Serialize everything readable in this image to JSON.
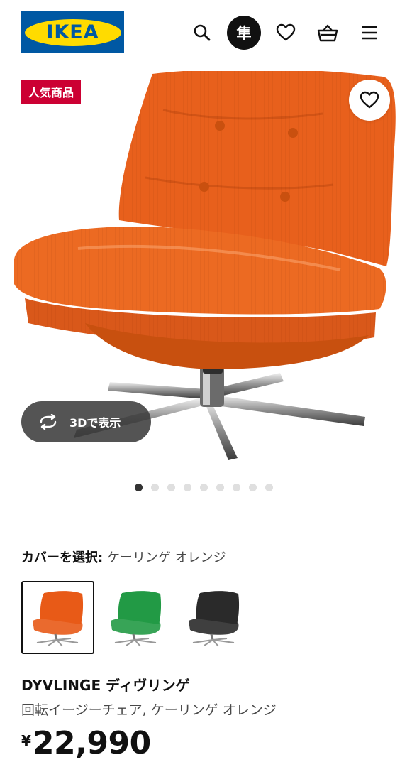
{
  "header": {
    "logo_text": "IKEA",
    "icons": [
      "search-icon",
      "store-icon",
      "heart-icon",
      "cart-icon",
      "menu-icon"
    ],
    "store_badge": "隼"
  },
  "gallery": {
    "badge": "人気商品",
    "view_3d_label": "3Dで表示",
    "image_count": 9,
    "active_index": 0
  },
  "cover": {
    "label": "カバーを選択:",
    "value": "ケーリンゲ オレンジ",
    "options": [
      {
        "color": "#e85a17",
        "selected": true
      },
      {
        "color": "#229a45",
        "selected": false
      },
      {
        "color": "#2a2a2a",
        "selected": false
      }
    ]
  },
  "product": {
    "name": "DYVLINGE ディヴリンゲ",
    "description": "回転イージーチェア, ケーリンゲ オレンジ",
    "currency": "¥",
    "price": "22,990"
  },
  "colors": {
    "ikea_blue": "#0058a3",
    "ikea_yellow": "#ffdb00",
    "badge_red": "#cc0033",
    "chair_orange": "#e85a17"
  }
}
